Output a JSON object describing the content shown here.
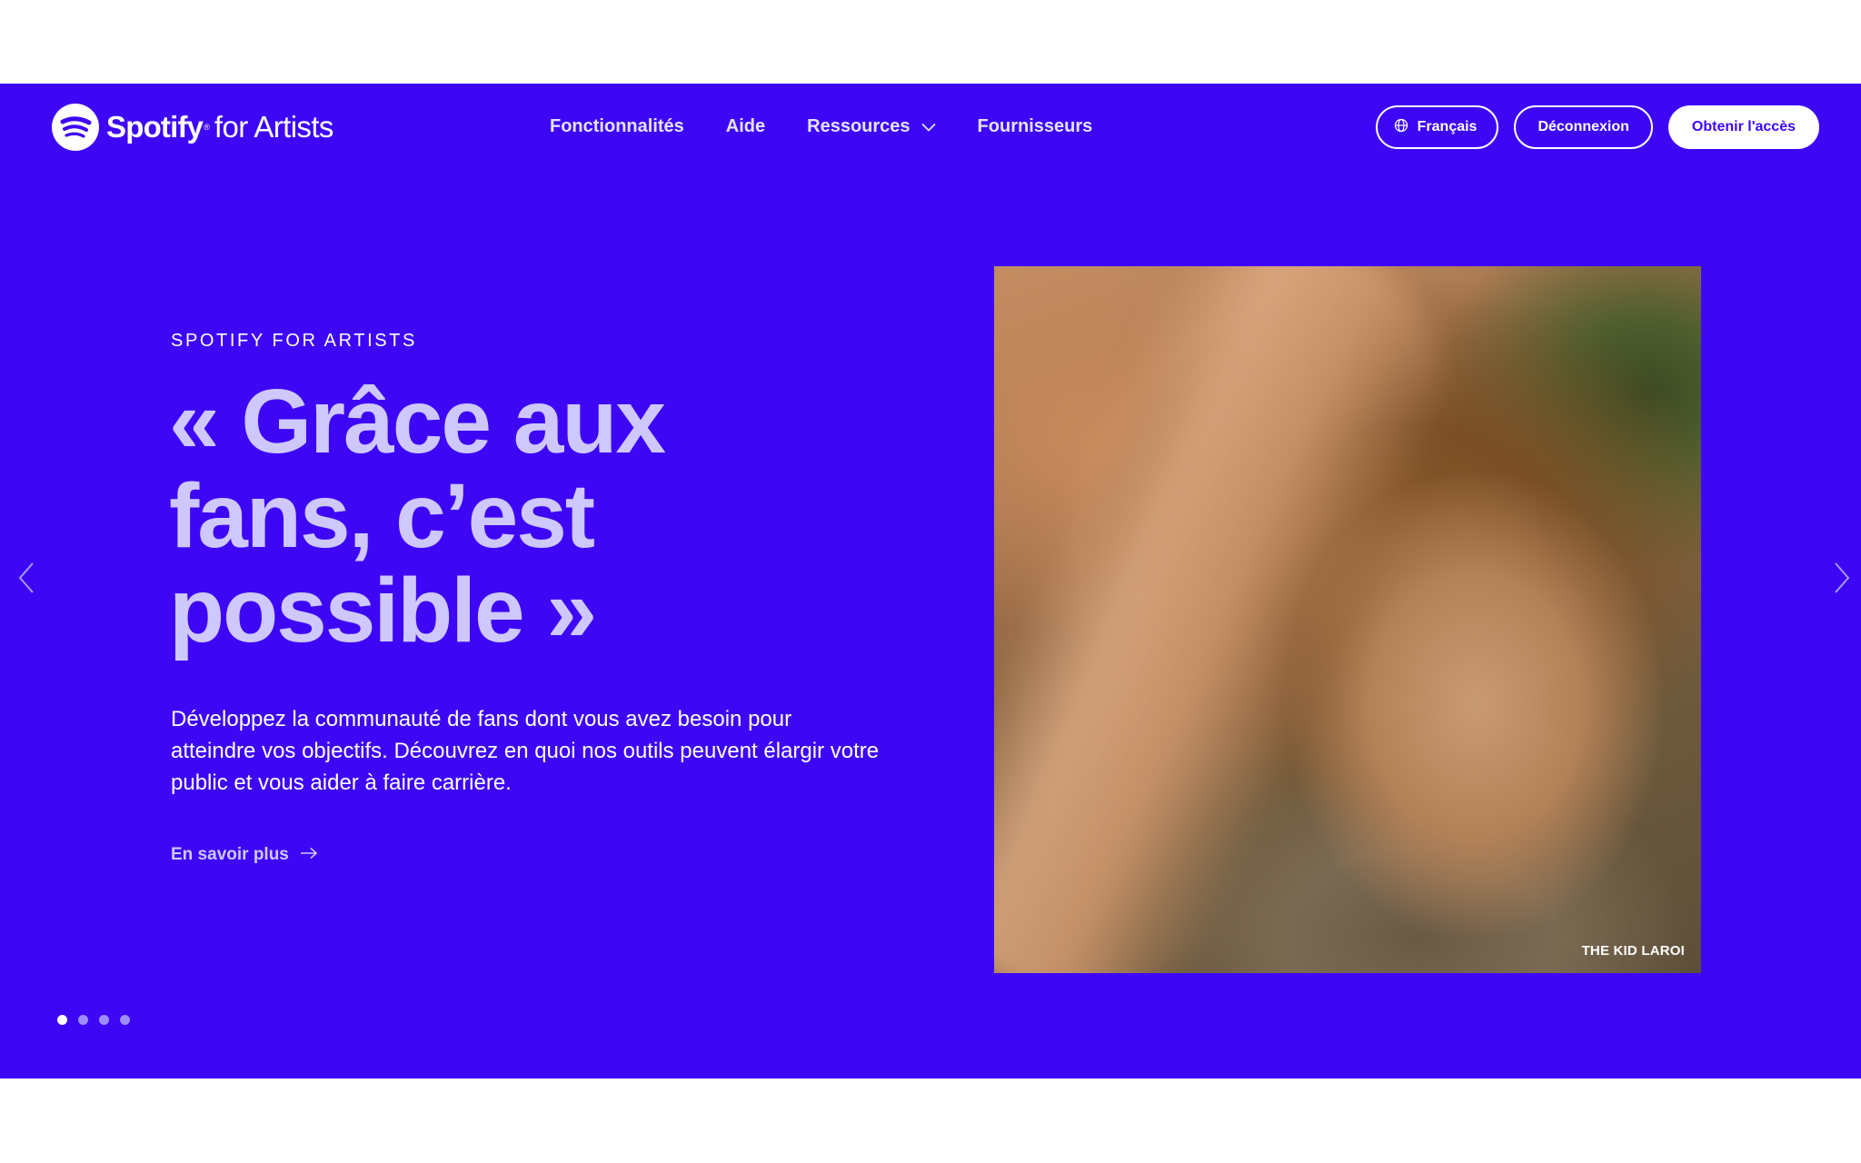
{
  "header": {
    "logo_brand": "Spotify",
    "logo_reg": "®",
    "logo_sub": "for Artists",
    "nav": [
      {
        "label": "Fonctionnalités"
      },
      {
        "label": "Aide"
      },
      {
        "label": "Ressources",
        "icon": "chevron-down-icon"
      },
      {
        "label": "Fournisseurs"
      }
    ],
    "language_button": "Français",
    "logout_button": "Déconnexion",
    "cta_button": "Obtenir l'accès"
  },
  "hero": {
    "eyebrow": "SPOTIFY FOR ARTISTS",
    "headline": "« Grâce aux fans, c’est possible »",
    "lede": "Développez la communauté de fans dont vous avez besoin pour atteindre vos objectifs. Découvrez en quoi nos outils peuvent élargir votre public et vous aider à faire carrière.",
    "learn_more": "En savoir plus",
    "photo_caption": "THE KID LAROI"
  },
  "carousel": {
    "slide_count": 4,
    "active_index": 0
  },
  "colors": {
    "background": "#3d07f6",
    "headline": "#cfc8ff",
    "white": "#ffffff"
  }
}
